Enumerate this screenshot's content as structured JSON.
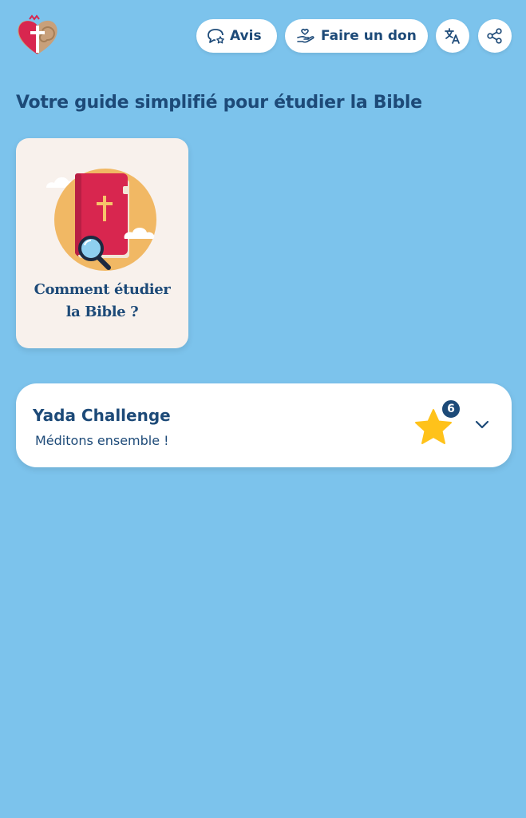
{
  "header": {
    "logo_icon": "sacred-heart-cross-logo",
    "avis_label": "Avis",
    "avis_icon": "chat-star-icon",
    "donate_label": "Faire un don",
    "donate_icon": "hand-heart-icon",
    "translate_icon": "translate-icon",
    "share_icon": "share-icon"
  },
  "page": {
    "title": "Votre guide simplifié pour étudier la Bible"
  },
  "guide_card": {
    "title_line1": "Comment étudier",
    "title_line2": "la Bible ?",
    "illustration_icon": "bible-magnifier-icon"
  },
  "challenge": {
    "title": "Yada Challenge",
    "subtitle": "Méditons ensemble !",
    "star_count": "6",
    "star_icon": "star-icon",
    "expand_icon": "chevron-down-icon"
  },
  "colors": {
    "background": "#7cc3ec",
    "text_primary": "#1d4a78",
    "card_white": "#ffffff",
    "guide_card_bg": "#f8f1ec",
    "star": "#ffc21a",
    "book": "#d8264f"
  }
}
